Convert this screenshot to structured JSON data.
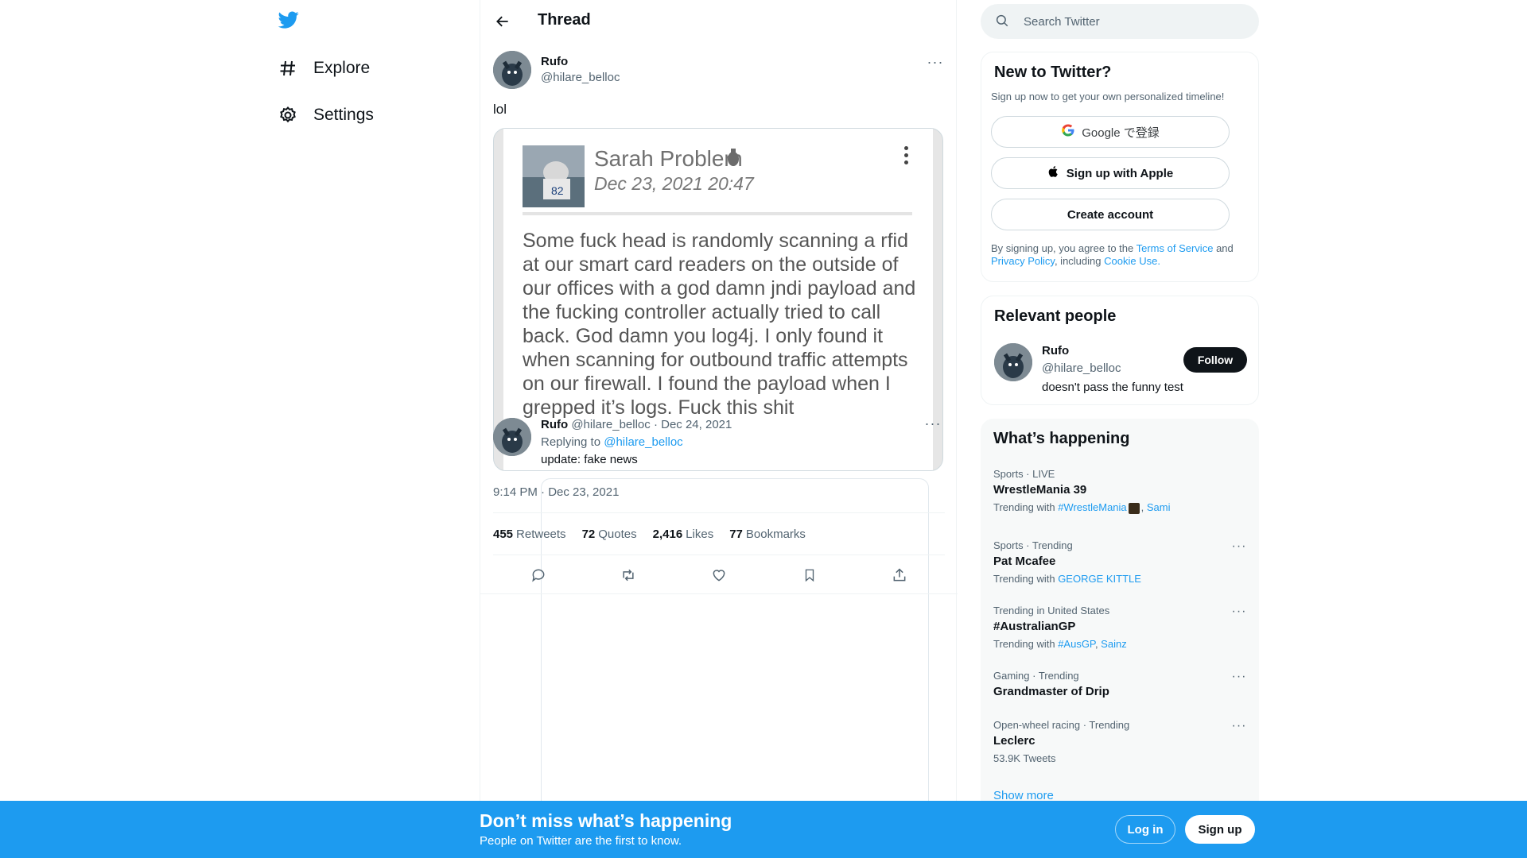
{
  "nav": {
    "items": [
      {
        "label": "Explore",
        "icon": "hashtag-icon"
      },
      {
        "label": "Settings",
        "icon": "gear-icon"
      }
    ]
  },
  "header": {
    "title": "Thread"
  },
  "tweet": {
    "author_name": "Rufo",
    "author_handle": "@hilare_belloc",
    "text": "lol",
    "timestamp": "9:14 PM · Dec 23, 2021",
    "stats": {
      "retweets": "455",
      "retweets_label": "Retweets",
      "quotes": "72",
      "quotes_label": "Quotes",
      "likes": "2,416",
      "likes_label": "Likes",
      "bookmarks": "77",
      "bookmarks_label": "Bookmarks"
    }
  },
  "embedded_image": {
    "name": "Sarah Problem",
    "date": "Dec 23, 2021 20:47",
    "body": "Some fuck head is randomly scanning a rfid at our smart card readers on the outside of our offices with a god damn jndi payload and the fucking controller actually tried to call back. God damn you log4j. I only found it when scanning for outbound traffic attempts on our firewall. I found the payload when I grepped it’s logs. Fuck this shit"
  },
  "reply": {
    "author_name": "Rufo",
    "author_handle": "@hilare_belloc",
    "date": "· Dec 24, 2021",
    "replying_prefix": "Replying to",
    "replying_to": "@hilare_belloc",
    "text": "update: fake news"
  },
  "search": {
    "placeholder": "Search Twitter"
  },
  "new_to_twitter": {
    "title": "New to Twitter?",
    "subtitle": "Sign up now to get your own personalized timeline!",
    "google_label": "Google で登録",
    "apple_label": "Sign up with Apple",
    "create_label": "Create account",
    "terms_prefix": "By signing up, you agree to the",
    "terms_link": "Terms of Service",
    "terms_and": "and",
    "privacy_link": "Privacy Policy",
    "including": ", including",
    "cookie_link": "Cookie Use."
  },
  "relevant_people": {
    "title": "Relevant people",
    "name": "Rufo",
    "handle": "@hilare_belloc",
    "bio": "doesn't pass the funny test",
    "follow_label": "Follow"
  },
  "whats_happening": {
    "title": "What’s happening",
    "trends": [
      {
        "meta": "Sports · LIVE",
        "name": "WrestleMania 39",
        "with_prefix": "Trending with",
        "with_links": [
          "#WrestleMania",
          "Sami"
        ]
      },
      {
        "meta": "Sports · Trending",
        "name": "Pat Mcafee",
        "with_prefix": "Trending with",
        "with_links": [
          "GEORGE KITTLE"
        ]
      },
      {
        "meta": "Trending in United States",
        "name": "#AustralianGP",
        "with_prefix": "Trending with",
        "with_links": [
          "#AusGP",
          "Sainz"
        ]
      },
      {
        "meta": "Gaming · Trending",
        "name": "Grandmaster of Drip"
      },
      {
        "meta": "Open-wheel racing · Trending",
        "name": "Leclerc",
        "count": "53.9K Tweets"
      }
    ],
    "show_more": "Show more"
  },
  "banner": {
    "title": "Don’t miss what’s happening",
    "subtitle": "People on Twitter are the first to know.",
    "login_label": "Log in",
    "signup_label": "Sign up"
  },
  "colors": {
    "accent": "#1d9bf0",
    "text": "#0f1419",
    "muted": "#536471"
  }
}
